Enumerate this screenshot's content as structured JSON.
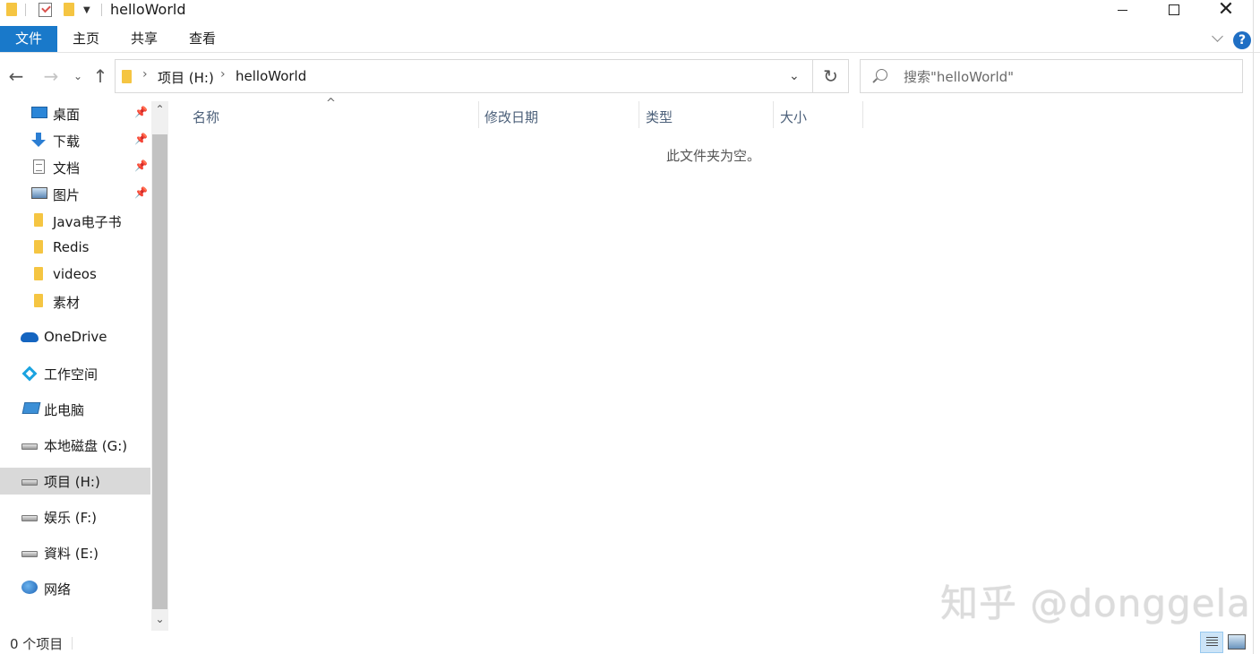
{
  "window": {
    "title": "helloWorld",
    "minimize_label": "",
    "close_glyph": "✕"
  },
  "ribbon": {
    "tabs": [
      {
        "label": "文件",
        "active": true
      },
      {
        "label": "主页"
      },
      {
        "label": "共享"
      },
      {
        "label": "查看"
      }
    ],
    "help_glyph": "?"
  },
  "address": {
    "crumbs": [
      "项目 (H:)",
      "helloWorld"
    ],
    "refresh_glyph": "↻"
  },
  "search": {
    "placeholder": "搜索\"helloWorld\""
  },
  "nav_pane": {
    "quick_access": [
      {
        "label": "桌面",
        "icon": "desktop-icon",
        "pinned": true
      },
      {
        "label": "下载",
        "icon": "download-icon",
        "pinned": true
      },
      {
        "label": "文档",
        "icon": "document-icon",
        "pinned": true
      },
      {
        "label": "图片",
        "icon": "pictures-icon",
        "pinned": true
      },
      {
        "label": "Java电子书",
        "icon": "folder-icon"
      },
      {
        "label": "Redis",
        "icon": "folder-icon"
      },
      {
        "label": "videos",
        "icon": "folder-icon"
      },
      {
        "label": "素材",
        "icon": "folder-icon"
      }
    ],
    "locations": [
      {
        "label": "OneDrive",
        "icon": "onedrive-icon"
      },
      {
        "label": "工作空间",
        "icon": "workspace-icon"
      },
      {
        "label": "此电脑",
        "icon": "this-pc-icon"
      },
      {
        "label": "本地磁盘 (G:)",
        "icon": "drive-icon"
      },
      {
        "label": "项目 (H:)",
        "icon": "drive-icon",
        "selected": true
      },
      {
        "label": "娱乐 (F:)",
        "icon": "drive-icon"
      },
      {
        "label": "資料 (E:)",
        "icon": "drive-icon"
      },
      {
        "label": "网络",
        "icon": "network-icon"
      }
    ],
    "pin_glyph": "📌"
  },
  "file_list": {
    "columns": [
      "名称",
      "修改日期",
      "类型",
      "大小"
    ],
    "sort_glyph": "^",
    "empty_message": "此文件夹为空。"
  },
  "status_bar": {
    "item_count": "0 个项目"
  },
  "watermark": {
    "text": "知乎 @donggela"
  },
  "colors": {
    "accent": "#1979ca",
    "selection": "#d9d9d9",
    "folder": "#f5c542"
  }
}
